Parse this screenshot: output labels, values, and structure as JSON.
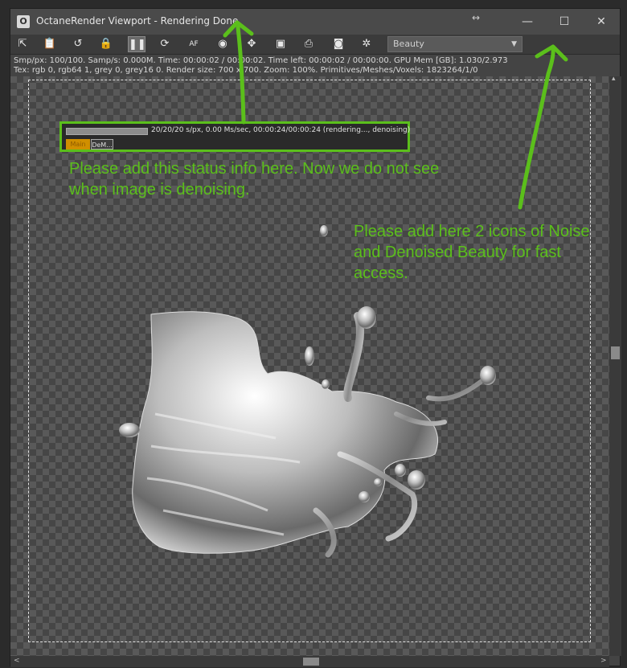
{
  "window": {
    "title": "OctaneRender Viewport - Rendering Done",
    "resize_glyph": "↔",
    "minimize_glyph": "—",
    "maximize_glyph": "☐",
    "close_glyph": "✕"
  },
  "toolbar": {
    "buttons": [
      {
        "icon": "send-to-picture-viewer-icon",
        "glyph": "⇱"
      },
      {
        "icon": "clipboard-icon",
        "glyph": "📋"
      },
      {
        "icon": "restart-render-icon",
        "glyph": "↺"
      },
      {
        "icon": "lock-icon",
        "glyph": "🔒"
      },
      {
        "icon": "pause-icon",
        "glyph": "❚❚"
      },
      {
        "icon": "refresh-icon",
        "glyph": "⟳"
      },
      {
        "icon": "auto-focus-icon",
        "glyph": "AF"
      },
      {
        "icon": "object-picker-icon",
        "glyph": "◉"
      },
      {
        "icon": "material-picker-icon",
        "glyph": "✥"
      },
      {
        "icon": "render-region-icon",
        "glyph": "▣"
      },
      {
        "icon": "print-icon",
        "glyph": "⎙"
      },
      {
        "icon": "camera-icon",
        "glyph": "◙"
      },
      {
        "icon": "settings-icon",
        "glyph": "✲"
      }
    ],
    "render_pass": "Beauty",
    "render_pass_caret": "▼"
  },
  "info": {
    "line1": "Smp/px: 100/100.   Samp/s: 0.000M.   Time: 00:00:02 / 00:00:02.   Time left: 00:00:02 / 00:00:00.   GPU Mem [GB]: 1.030/2.973",
    "line2": "Tex: rgb 0, rgb64 1, grey 0, grey16 0.   Render size: 700 x 700.   Zoom: 100%.   Primitives/Meshes/Voxels: 1823264/1/0"
  },
  "status_panel": {
    "progress": 1.0,
    "text": "20/20/20 s/px, 0.00 Ms/sec, 00:00:24/00:00:24 (rendering..., denoising)",
    "tabs": [
      "Main",
      "DeM..."
    ]
  },
  "annotations": {
    "status_note": "Please add this status info here. Now we do not see when image is denoising.",
    "icons_note": "Please add here 2 icons of Noise and Denoised Beauty for fast access."
  },
  "scrollbars": {
    "left_glyph": "<",
    "right_glyph": ">",
    "up_glyph": "▴"
  },
  "colors": {
    "annotation": "#5bbf1b",
    "main_tab": "#d08f00"
  }
}
